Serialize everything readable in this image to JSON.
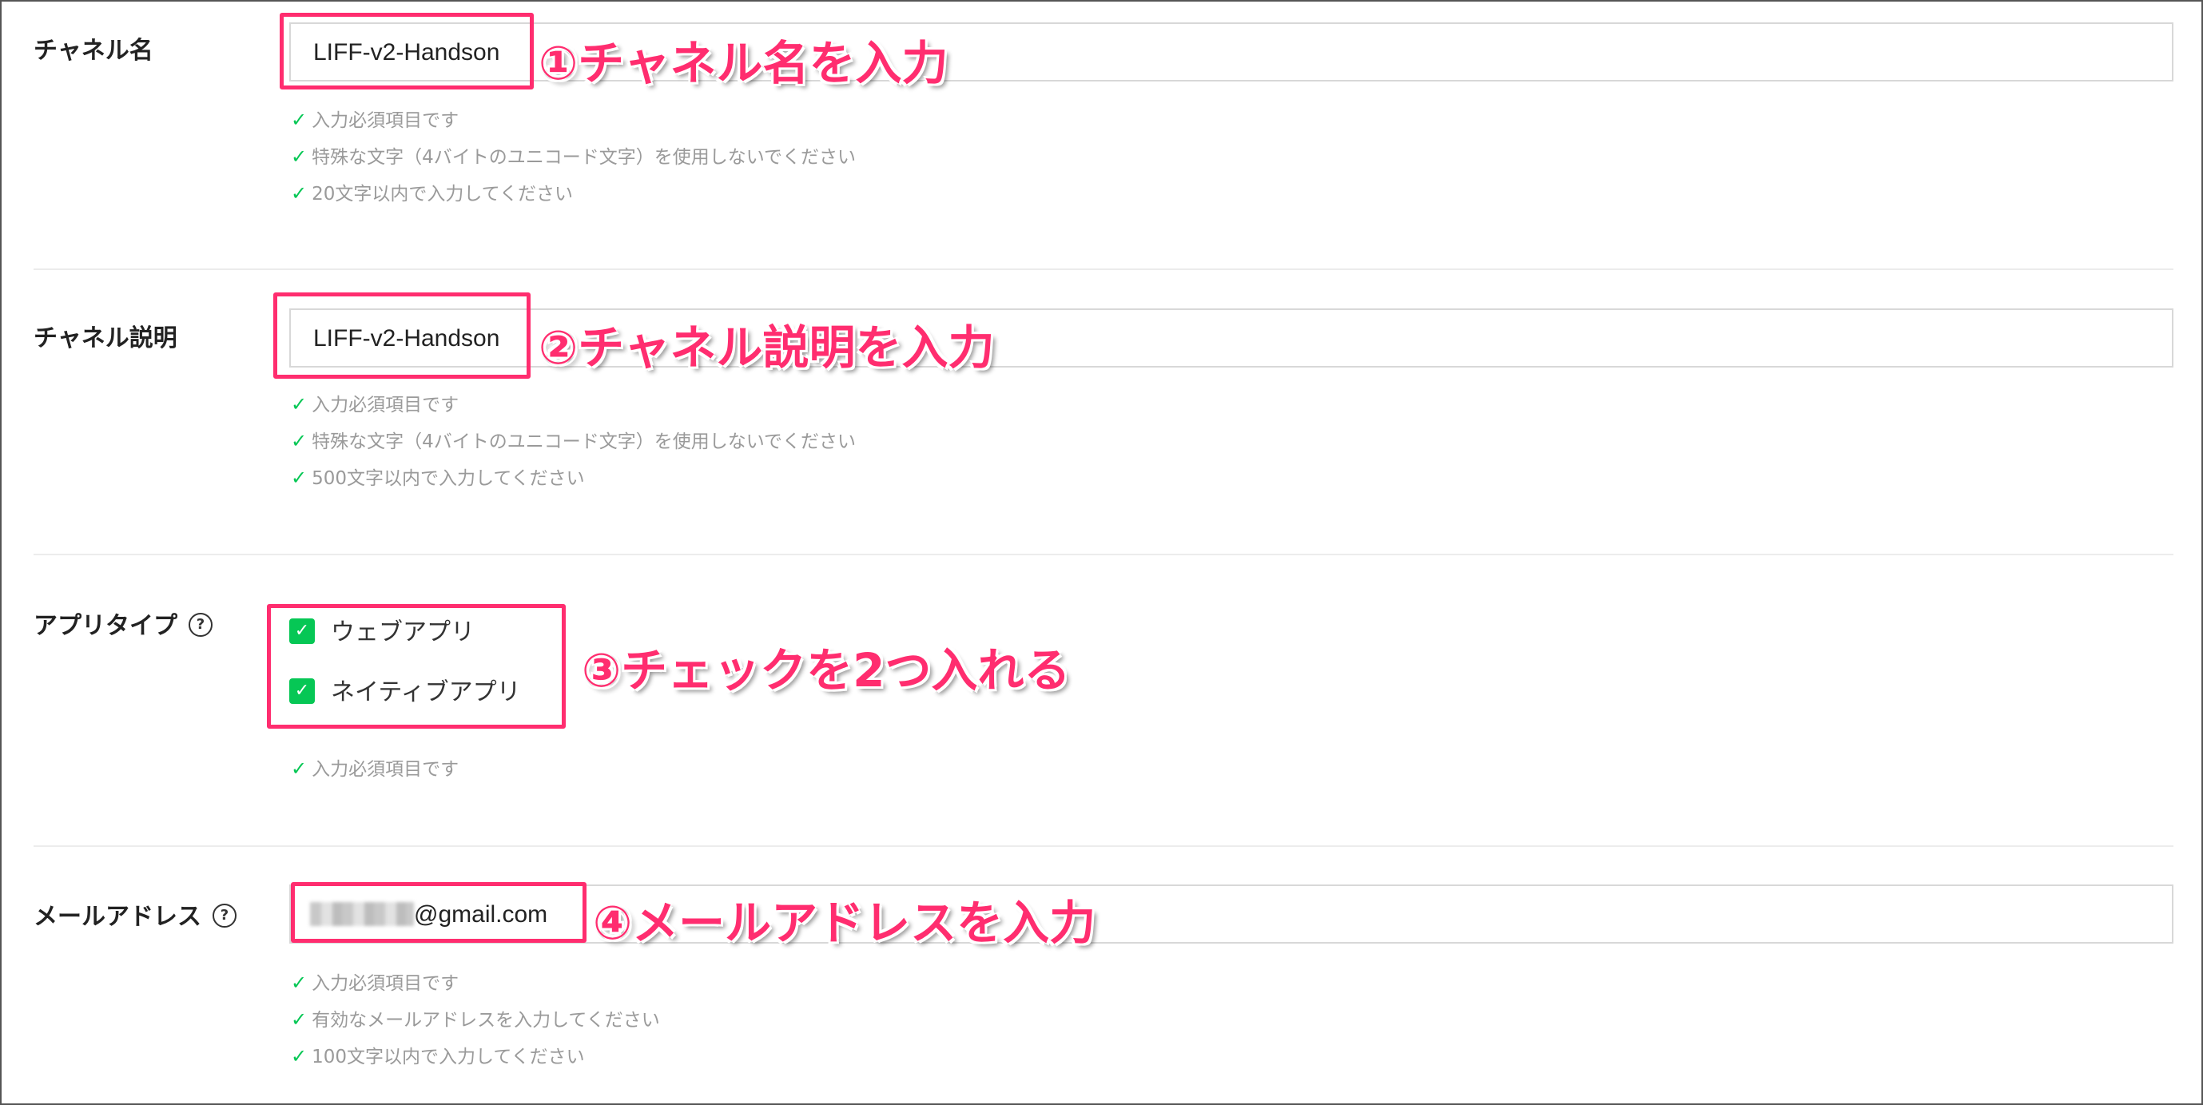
{
  "sections": {
    "channel_name": {
      "label": "チャネル名",
      "value": "LIFF-v2-Handson",
      "annotation": "①チャネル名を入力",
      "validations": [
        "入力必須項目です",
        "特殊な文字（4バイトのユニコード文字）を使用しないでください",
        "20文字以内で入力してください"
      ]
    },
    "channel_description": {
      "label": "チャネル説明",
      "value": "LIFF-v2-Handson",
      "annotation": "②チャネル説明を入力",
      "validations": [
        "入力必須項目です",
        "特殊な文字（4バイトのユニコード文字）を使用しないでください",
        "500文字以内で入力してください"
      ]
    },
    "app_type": {
      "label": "アプリタイプ",
      "help_icon": "?",
      "options": [
        {
          "label": "ウェブアプリ",
          "checked": true
        },
        {
          "label": "ネイティブアプリ",
          "checked": true
        }
      ],
      "annotation": "③チェックを2つ入れる",
      "validations": [
        "入力必須項目です"
      ]
    },
    "email": {
      "label": "メールアドレス",
      "help_icon": "?",
      "value_suffix": "@gmail.com",
      "annotation": "④メールアドレスを入力",
      "validations": [
        "入力必須項目です",
        "有効なメールアドレスを入力してください",
        "100文字以内で入力してください"
      ]
    }
  },
  "icons": {
    "check": "✓"
  },
  "colors": {
    "accent": "#06c755",
    "annotation": "#ff2d6f",
    "validation_text": "#9a9a9a"
  }
}
